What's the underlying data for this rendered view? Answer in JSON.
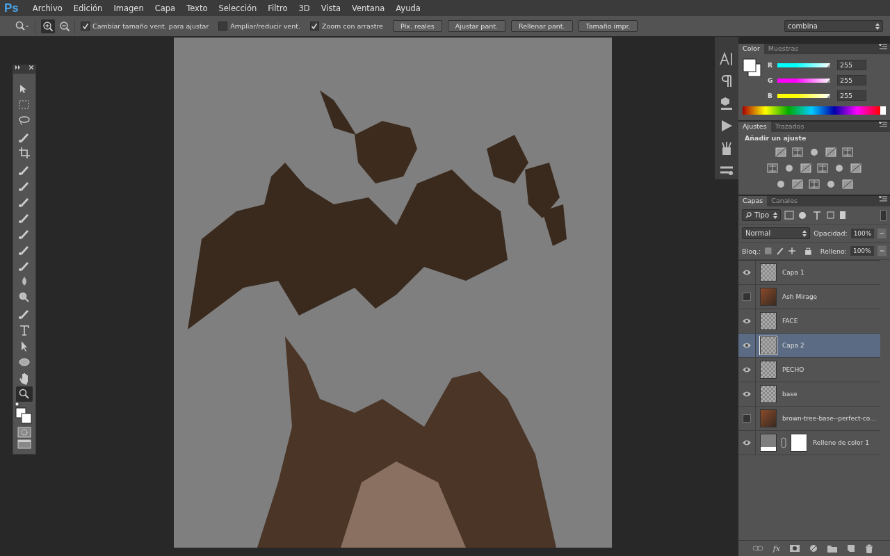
{
  "app": {
    "logo": "Ps"
  },
  "menu": [
    "Archivo",
    "Edición",
    "Imagen",
    "Capa",
    "Texto",
    "Selección",
    "Filtro",
    "3D",
    "Vista",
    "Ventana",
    "Ayuda"
  ],
  "options_bar": {
    "zoom_modes": [
      {
        "kind": "zoom-in",
        "selected": true
      },
      {
        "kind": "zoom-out",
        "selected": false
      }
    ],
    "checkboxes": [
      {
        "label": "Cambiar tamaño vent. para ajustar",
        "checked": true
      },
      {
        "label": "Ampliar/reducir vent.",
        "checked": false
      },
      {
        "label": "Zoom con arrastre",
        "checked": true
      }
    ],
    "buttons": [
      "Píx. reales",
      "Ajustar pant.",
      "Rellenar pant.",
      "Tamaño impr."
    ],
    "workspace": "combina"
  },
  "tools": [
    {
      "kind": "move",
      "selected": false
    },
    {
      "kind": "marquee",
      "selected": false
    },
    {
      "kind": "lasso",
      "selected": false
    },
    {
      "kind": "quick-select",
      "selected": false
    },
    {
      "kind": "crop",
      "selected": false
    },
    {
      "kind": "eyedropper",
      "selected": false
    },
    {
      "kind": "healing",
      "selected": false
    },
    {
      "kind": "brush",
      "selected": false
    },
    {
      "kind": "stamp",
      "selected": false
    },
    {
      "kind": "history-brush",
      "selected": false
    },
    {
      "kind": "eraser",
      "selected": false
    },
    {
      "kind": "bucket",
      "selected": false
    },
    {
      "kind": "blur",
      "selected": false
    },
    {
      "kind": "dodge",
      "selected": false
    },
    {
      "kind": "pen",
      "selected": false
    },
    {
      "kind": "type",
      "selected": false
    },
    {
      "kind": "path-select",
      "selected": false
    },
    {
      "kind": "ellipse",
      "selected": false
    },
    {
      "kind": "hand",
      "selected": false
    },
    {
      "kind": "zoom",
      "selected": true
    }
  ],
  "color_panel": {
    "tabs": [
      {
        "label": "Color",
        "selected": true
      },
      {
        "label": "Muestras",
        "selected": false
      }
    ],
    "channels": [
      {
        "label": "R",
        "value": "255",
        "level": 1,
        "color": "#00ffff"
      },
      {
        "label": "G",
        "value": "255",
        "level": 1,
        "color": "#ff00ff"
      },
      {
        "label": "B",
        "value": "255",
        "level": 1,
        "color": "#ffff00"
      }
    ]
  },
  "adjustments_panel": {
    "tabs": [
      {
        "label": "Ajustes",
        "selected": true
      },
      {
        "label": "Trazados",
        "selected": false
      }
    ],
    "heading": "Añadir un ajuste"
  },
  "layers_panel": {
    "tabs": [
      {
        "label": "Capas",
        "selected": true
      },
      {
        "label": "Canales",
        "selected": false
      }
    ],
    "filter": "Tipo",
    "blend_mode": "Normal",
    "opacity_label": "Opacidad:",
    "opacity": "100%",
    "lock_label": "Bloq.:",
    "fill_label": "Relleno:",
    "fill": "100%",
    "layers": [
      {
        "name": "Capa 1",
        "visible": true,
        "selected": false,
        "kind": "pixel"
      },
      {
        "name": "Ash Mirage",
        "visible": false,
        "selected": false,
        "kind": "smart"
      },
      {
        "name": "FACE",
        "visible": true,
        "selected": false,
        "kind": "pixel"
      },
      {
        "name": "Capa 2",
        "visible": true,
        "selected": true,
        "kind": "pixel"
      },
      {
        "name": "PECHO",
        "visible": true,
        "selected": false,
        "kind": "pixel"
      },
      {
        "name": "base",
        "visible": true,
        "selected": false,
        "kind": "pixel"
      },
      {
        "name": "brown-tree-base--perfect-co...",
        "visible": false,
        "selected": false,
        "kind": "smart"
      },
      {
        "name": "Relleno de color 1",
        "visible": true,
        "selected": false,
        "kind": "fill"
      }
    ],
    "footer": {
      "fx_label": "fx"
    }
  }
}
